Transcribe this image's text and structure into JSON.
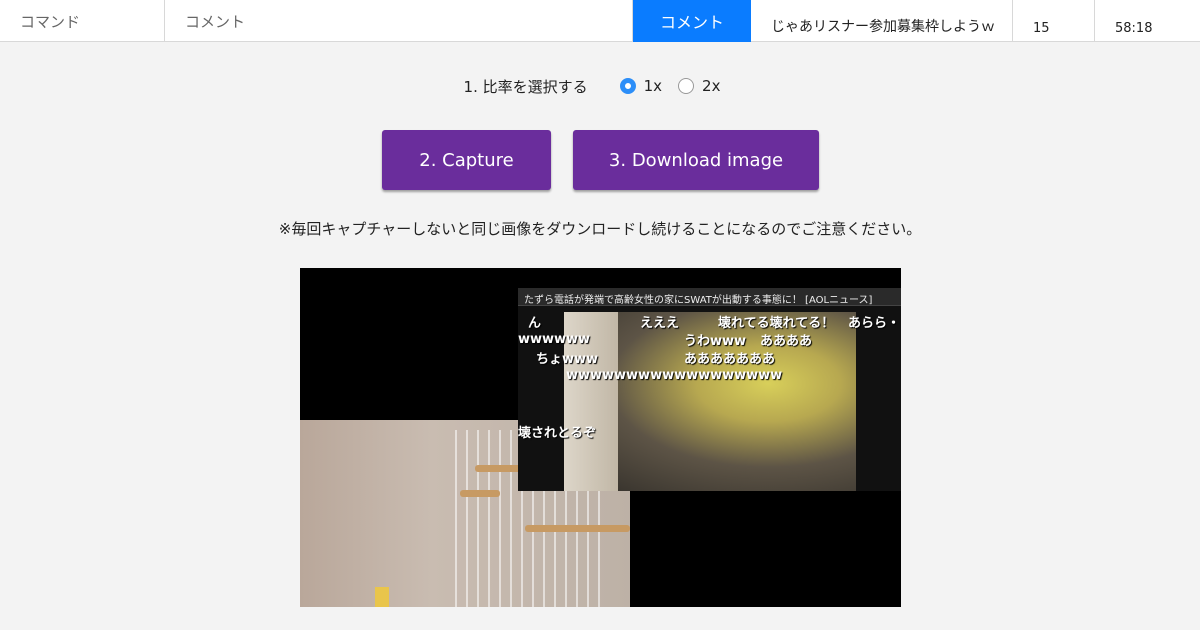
{
  "topbar": {
    "command_placeholder": "コマンド",
    "comment_placeholder": "コメント",
    "submit_label": "コメント",
    "latest_comment": "じゃあリスナー参加募集枠しようｗ",
    "comment_count": "15",
    "elapsed_time": "58:18"
  },
  "ratio": {
    "label": "1. 比率を選択する",
    "options": [
      {
        "label": "1x",
        "checked": true
      },
      {
        "label": "2x",
        "checked": false
      }
    ]
  },
  "buttons": {
    "capture_label": "2. Capture",
    "download_label": "3. Download image"
  },
  "notice": "※毎回キャプチャーしないと同じ画像をダウンロードし続けることになるのでご注意ください。",
  "colors": {
    "submit_blue": "#0a7cff",
    "button_purple": "#6a2d9c",
    "radio_blue": "#2c8ef8"
  },
  "captured_image": {
    "news_ticker": "たずら電話が発端で高齢女性の家にSWATが出動する事態に！ [AOLニュース]",
    "overlay_comments": [
      "ん",
      "えええ",
      "壊れてる壊れてる！",
      "あらら・",
      "wwwwww",
      "うわwww",
      "ああああ",
      "ちょwww",
      "あああああああ",
      "wwwwwwwwwwwwwwwwww",
      "壊されとるぞ"
    ]
  }
}
